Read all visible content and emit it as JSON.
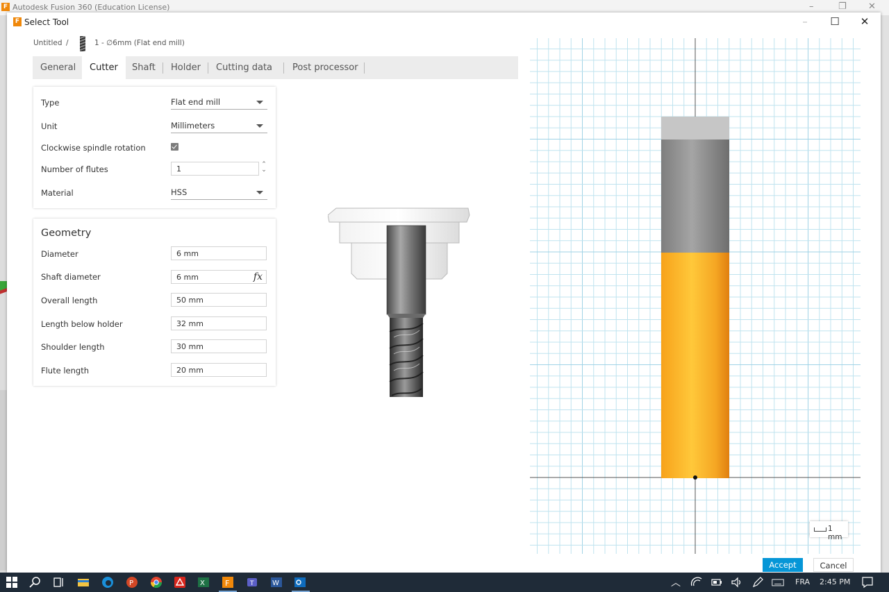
{
  "app": {
    "title": "Autodesk Fusion 360 (Education License)",
    "logo_letter": "F",
    "controls": [
      "–",
      "❐",
      "✕"
    ]
  },
  "dialog": {
    "title": "Select Tool",
    "logo_letter": "F",
    "controls": {
      "minimize": "–",
      "maximize": "☐",
      "close": "✕"
    }
  },
  "breadcrumb": {
    "root": "Untitled",
    "separator": "/",
    "tool": "1 - ∅6mm (Flat end mill)"
  },
  "tabs": [
    {
      "label": "General",
      "active": false
    },
    {
      "label": "Cutter",
      "active": true
    },
    {
      "label": "Shaft",
      "active": false
    },
    {
      "label": "Holder",
      "active": false
    },
    {
      "label": "Cutting data",
      "active": false
    },
    {
      "label": "Post processor",
      "active": false
    }
  ],
  "cutter": {
    "type_label": "Type",
    "type_value": "Flat end mill",
    "unit_label": "Unit",
    "unit_value": "Millimeters",
    "clockwise_label": "Clockwise spindle rotation",
    "clockwise_checked": true,
    "flutes_label": "Number of flutes",
    "flutes_value": "1",
    "material_label": "Material",
    "material_value": "HSS"
  },
  "geometry": {
    "title": "Geometry",
    "fields": [
      {
        "label": "Diameter",
        "value": "6 mm"
      },
      {
        "label": "Shaft diameter",
        "value": "6 mm",
        "fx": "fx"
      },
      {
        "label": "Overall length",
        "value": "50 mm"
      },
      {
        "label": "Length below holder",
        "value": "32 mm"
      },
      {
        "label": "Shoulder length",
        "value": "30 mm"
      },
      {
        "label": "Flute length",
        "value": "20 mm"
      }
    ]
  },
  "preview": {
    "scale_label": "1 mm",
    "colors": {
      "grid": "#bfe3ef",
      "grid_major": "#9fd2e6",
      "flute": "#f5a623",
      "shank": "#8c8c8c",
      "holder": "#c8c8c8"
    }
  },
  "buttons": {
    "accept": "Accept",
    "cancel": "Cancel"
  },
  "taskbar": {
    "icons": [
      "windows-start-icon",
      "search-icon",
      "task-view-icon",
      "file-explorer-icon",
      "edge-icon",
      "powerpoint-icon",
      "chrome-icon",
      "acrobat-icon",
      "excel-icon",
      "fusion360-icon",
      "teams-icon",
      "word-icon",
      "outlook-icon"
    ],
    "tray": {
      "language": "FRA",
      "time": "2:45 PM"
    }
  }
}
